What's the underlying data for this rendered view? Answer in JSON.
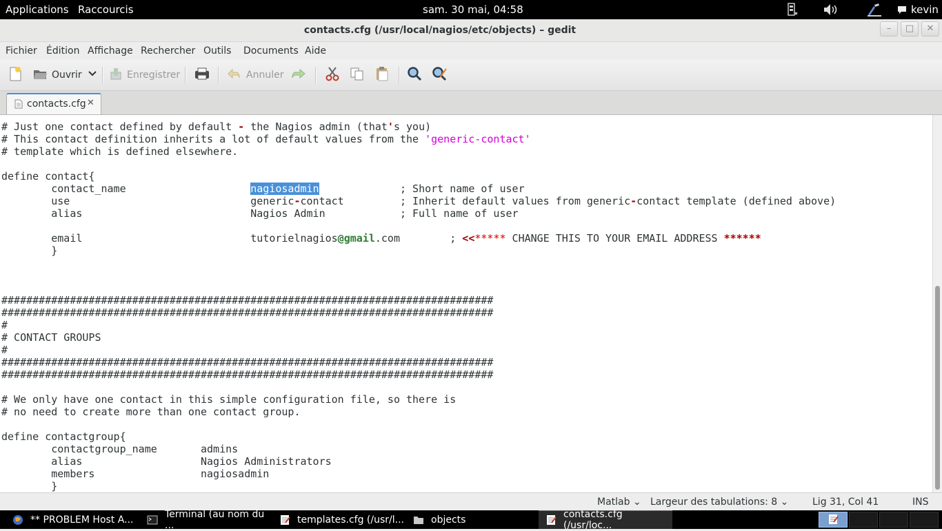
{
  "top_panel": {
    "applications": "Applications",
    "shortcuts": "Raccourcis",
    "clock": "sam. 30 mai, 04:58",
    "user": "kevin"
  },
  "window": {
    "title": "contacts.cfg (/usr/local/nagios/etc/objects) – gedit",
    "minimize": "–",
    "maximize": "□",
    "close": "✕"
  },
  "menubar": [
    "Fichier",
    "Édition",
    "Affichage",
    "Rechercher",
    "Outils",
    "Documents",
    "Aide"
  ],
  "toolbar": {
    "open": "Ouvrir",
    "save": "Enregistrer",
    "undo": "Annuler"
  },
  "tab": {
    "label": "contacts.cfg",
    "close": "✕"
  },
  "editor": {
    "lines": [
      "# Just one contact defined by default - the Nagios admin (that's you)",
      "# This contact definition inherits a lot of default values from the 'generic-contact'",
      "# template which is defined elsewhere.",
      "",
      "define contact{",
      "        contact_name                    nagiosadmin             ; Short name of user",
      "        use                             generic-contact         ; Inherit default values from generic-contact template (defined above)",
      "        alias                           Nagios Admin            ; Full name of user",
      "",
      "        email                           tutorielnagios@gmail.com        ; <<***** CHANGE THIS TO YOUR EMAIL ADDRESS ******",
      "        }",
      "",
      "",
      "",
      "###############################################################################",
      "###############################################################################",
      "#",
      "# CONTACT GROUPS",
      "#",
      "###############################################################################",
      "###############################################################################",
      "",
      "# We only have one contact in this simple configuration file, so there is",
      "# no need to create more than one contact group.",
      "",
      "define contactgroup{",
      "        contactgroup_name       admins",
      "        alias                   Nagios Administrators",
      "        members                 nagiosadmin",
      "        }"
    ]
  },
  "statusbar": {
    "language": "Matlab",
    "tab_width": "Largeur des tabulations:  8",
    "position": "Lig 31, Col 41",
    "mode": "INS"
  },
  "taskbar": [
    "** PROBLEM Host A...",
    "Terminal (au nom du ...",
    "templates.cfg (/usr/l...",
    "objects",
    "contacts.cfg (/usr/loc..."
  ],
  "colors": {
    "selection": "#4a90d9",
    "string": "#d400d4",
    "operator": "#a40000",
    "email_domain": "#2e7d32"
  }
}
